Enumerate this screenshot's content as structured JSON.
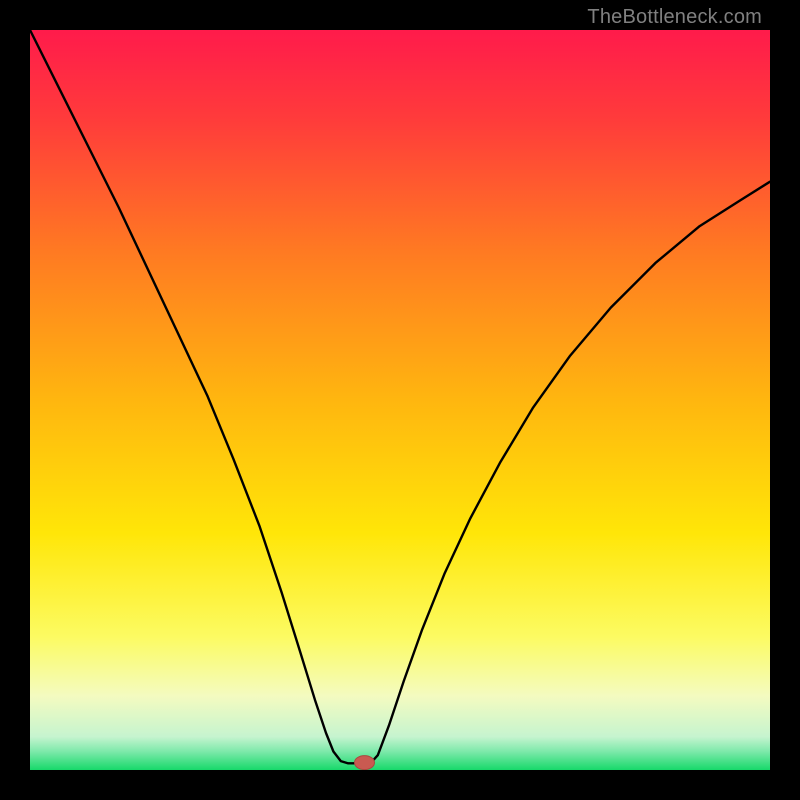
{
  "watermark": "TheBottleneck.com",
  "chart_data": {
    "type": "line",
    "title": "",
    "xlabel": "",
    "ylabel": "",
    "xlim": [
      0,
      1
    ],
    "ylim": [
      0,
      1
    ],
    "background_gradient": {
      "direction": "vertical",
      "stops": [
        {
          "t": 0.0,
          "color": "#ff1b4b"
        },
        {
          "t": 0.12,
          "color": "#ff3b3b"
        },
        {
          "t": 0.3,
          "color": "#ff7a22"
        },
        {
          "t": 0.5,
          "color": "#ffb60f"
        },
        {
          "t": 0.68,
          "color": "#ffe608"
        },
        {
          "t": 0.82,
          "color": "#fcfb62"
        },
        {
          "t": 0.9,
          "color": "#f4fbc0"
        },
        {
          "t": 0.955,
          "color": "#c6f4cf"
        },
        {
          "t": 0.975,
          "color": "#7de9aa"
        },
        {
          "t": 1.0,
          "color": "#17d96a"
        }
      ]
    },
    "series": [
      {
        "name": "bottleneck-curve",
        "color": "#000000",
        "width": 2.4,
        "segments": [
          [
            {
              "x": 0.0,
              "y": 1.0
            },
            {
              "x": 0.04,
              "y": 0.92
            },
            {
              "x": 0.08,
              "y": 0.84
            },
            {
              "x": 0.12,
              "y": 0.76
            },
            {
              "x": 0.16,
              "y": 0.675
            },
            {
              "x": 0.2,
              "y": 0.59
            },
            {
              "x": 0.24,
              "y": 0.505
            },
            {
              "x": 0.275,
              "y": 0.42
            },
            {
              "x": 0.31,
              "y": 0.33
            },
            {
              "x": 0.34,
              "y": 0.24
            },
            {
              "x": 0.365,
              "y": 0.16
            },
            {
              "x": 0.385,
              "y": 0.095
            },
            {
              "x": 0.4,
              "y": 0.05
            },
            {
              "x": 0.41,
              "y": 0.025
            },
            {
              "x": 0.42,
              "y": 0.012
            },
            {
              "x": 0.43,
              "y": 0.009
            },
            {
              "x": 0.45,
              "y": 0.009
            }
          ],
          [
            {
              "x": 0.46,
              "y": 0.009
            },
            {
              "x": 0.47,
              "y": 0.02
            },
            {
              "x": 0.485,
              "y": 0.06
            },
            {
              "x": 0.505,
              "y": 0.12
            },
            {
              "x": 0.53,
              "y": 0.19
            },
            {
              "x": 0.56,
              "y": 0.265
            },
            {
              "x": 0.595,
              "y": 0.34
            },
            {
              "x": 0.635,
              "y": 0.415
            },
            {
              "x": 0.68,
              "y": 0.49
            },
            {
              "x": 0.73,
              "y": 0.56
            },
            {
              "x": 0.785,
              "y": 0.625
            },
            {
              "x": 0.845,
              "y": 0.685
            },
            {
              "x": 0.905,
              "y": 0.735
            },
            {
              "x": 0.96,
              "y": 0.77
            },
            {
              "x": 1.0,
              "y": 0.795
            }
          ]
        ]
      }
    ],
    "marker": {
      "x": 0.452,
      "y": 0.01,
      "rx": 10,
      "ry": 7,
      "fill": "#c95a51",
      "stroke": "#a94840"
    }
  }
}
